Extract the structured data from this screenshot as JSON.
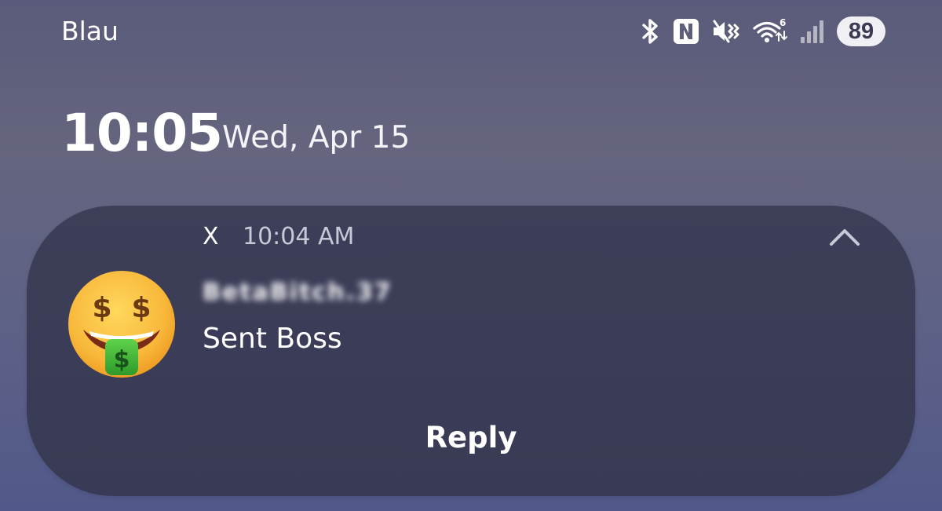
{
  "status_bar": {
    "carrier": "Blau",
    "battery": "89",
    "icons": [
      "bluetooth-icon",
      "nfc-icon",
      "vibrate-mute-icon",
      "wifi-6-icon",
      "signal-icon"
    ]
  },
  "lockscreen": {
    "time": "10:05",
    "date": "Wed, Apr 15"
  },
  "notification": {
    "app": "X",
    "time": "10:04 AM",
    "sender": "BetaBitch.37",
    "message": "Sent Boss",
    "action": "Reply",
    "avatar": "money-mouth-face-emoji",
    "collapse_icon": "chevron-up-icon"
  },
  "colors": {
    "background_top": "#5a5b7a",
    "background_bottom": "#52598a",
    "card": "#3b3d57",
    "text": "#ffffff",
    "muted_text": "#c8c9d6"
  }
}
